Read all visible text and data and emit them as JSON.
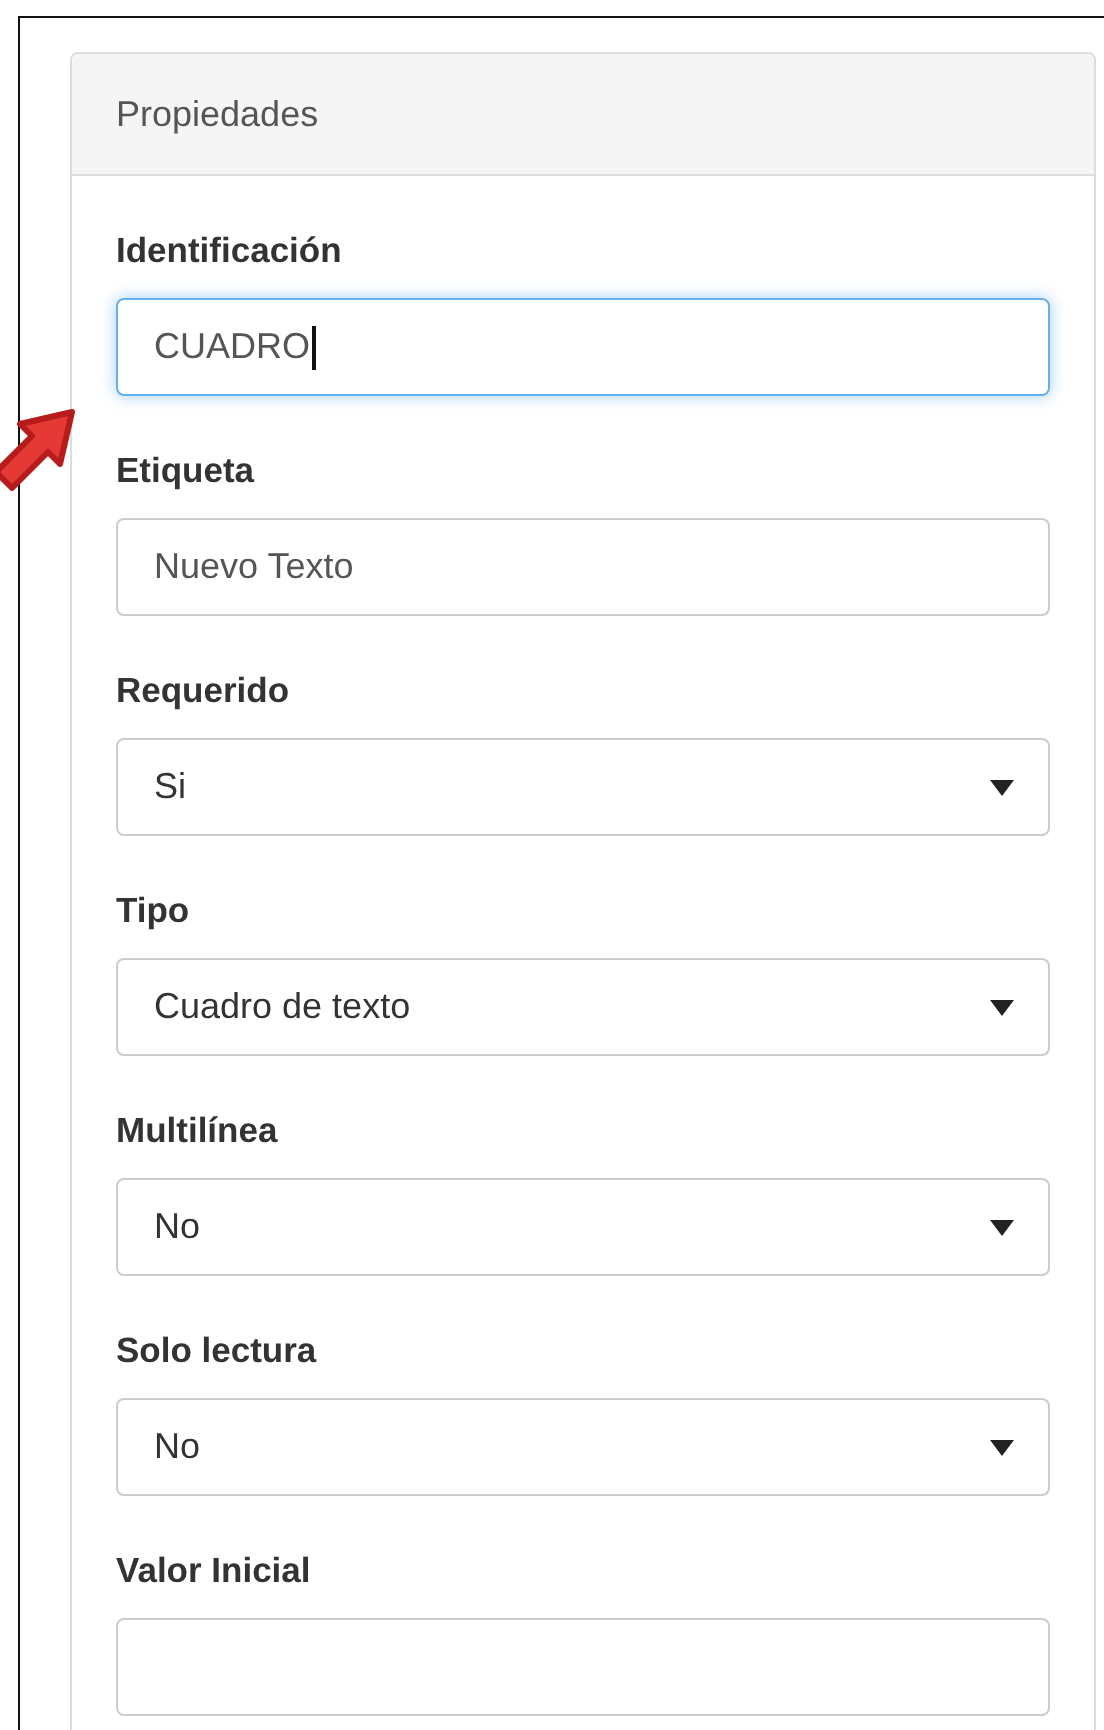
{
  "panel": {
    "title": "Propiedades"
  },
  "fields": [
    {
      "label": "Identificación",
      "kind": "text",
      "value": "CUADRO",
      "focused": true
    },
    {
      "label": "Etiqueta",
      "kind": "text",
      "value": "Nuevo Texto",
      "focused": false
    },
    {
      "label": "Requerido",
      "kind": "select",
      "value": "Si",
      "focused": false
    },
    {
      "label": "Tipo",
      "kind": "select",
      "value": "Cuadro de texto",
      "focused": false
    },
    {
      "label": "Multilínea",
      "kind": "select",
      "value": "No",
      "focused": false
    },
    {
      "label": "Solo lectura",
      "kind": "select",
      "value": "No",
      "focused": false
    },
    {
      "label": "Valor Inicial",
      "kind": "text",
      "focused": false
    }
  ]
}
